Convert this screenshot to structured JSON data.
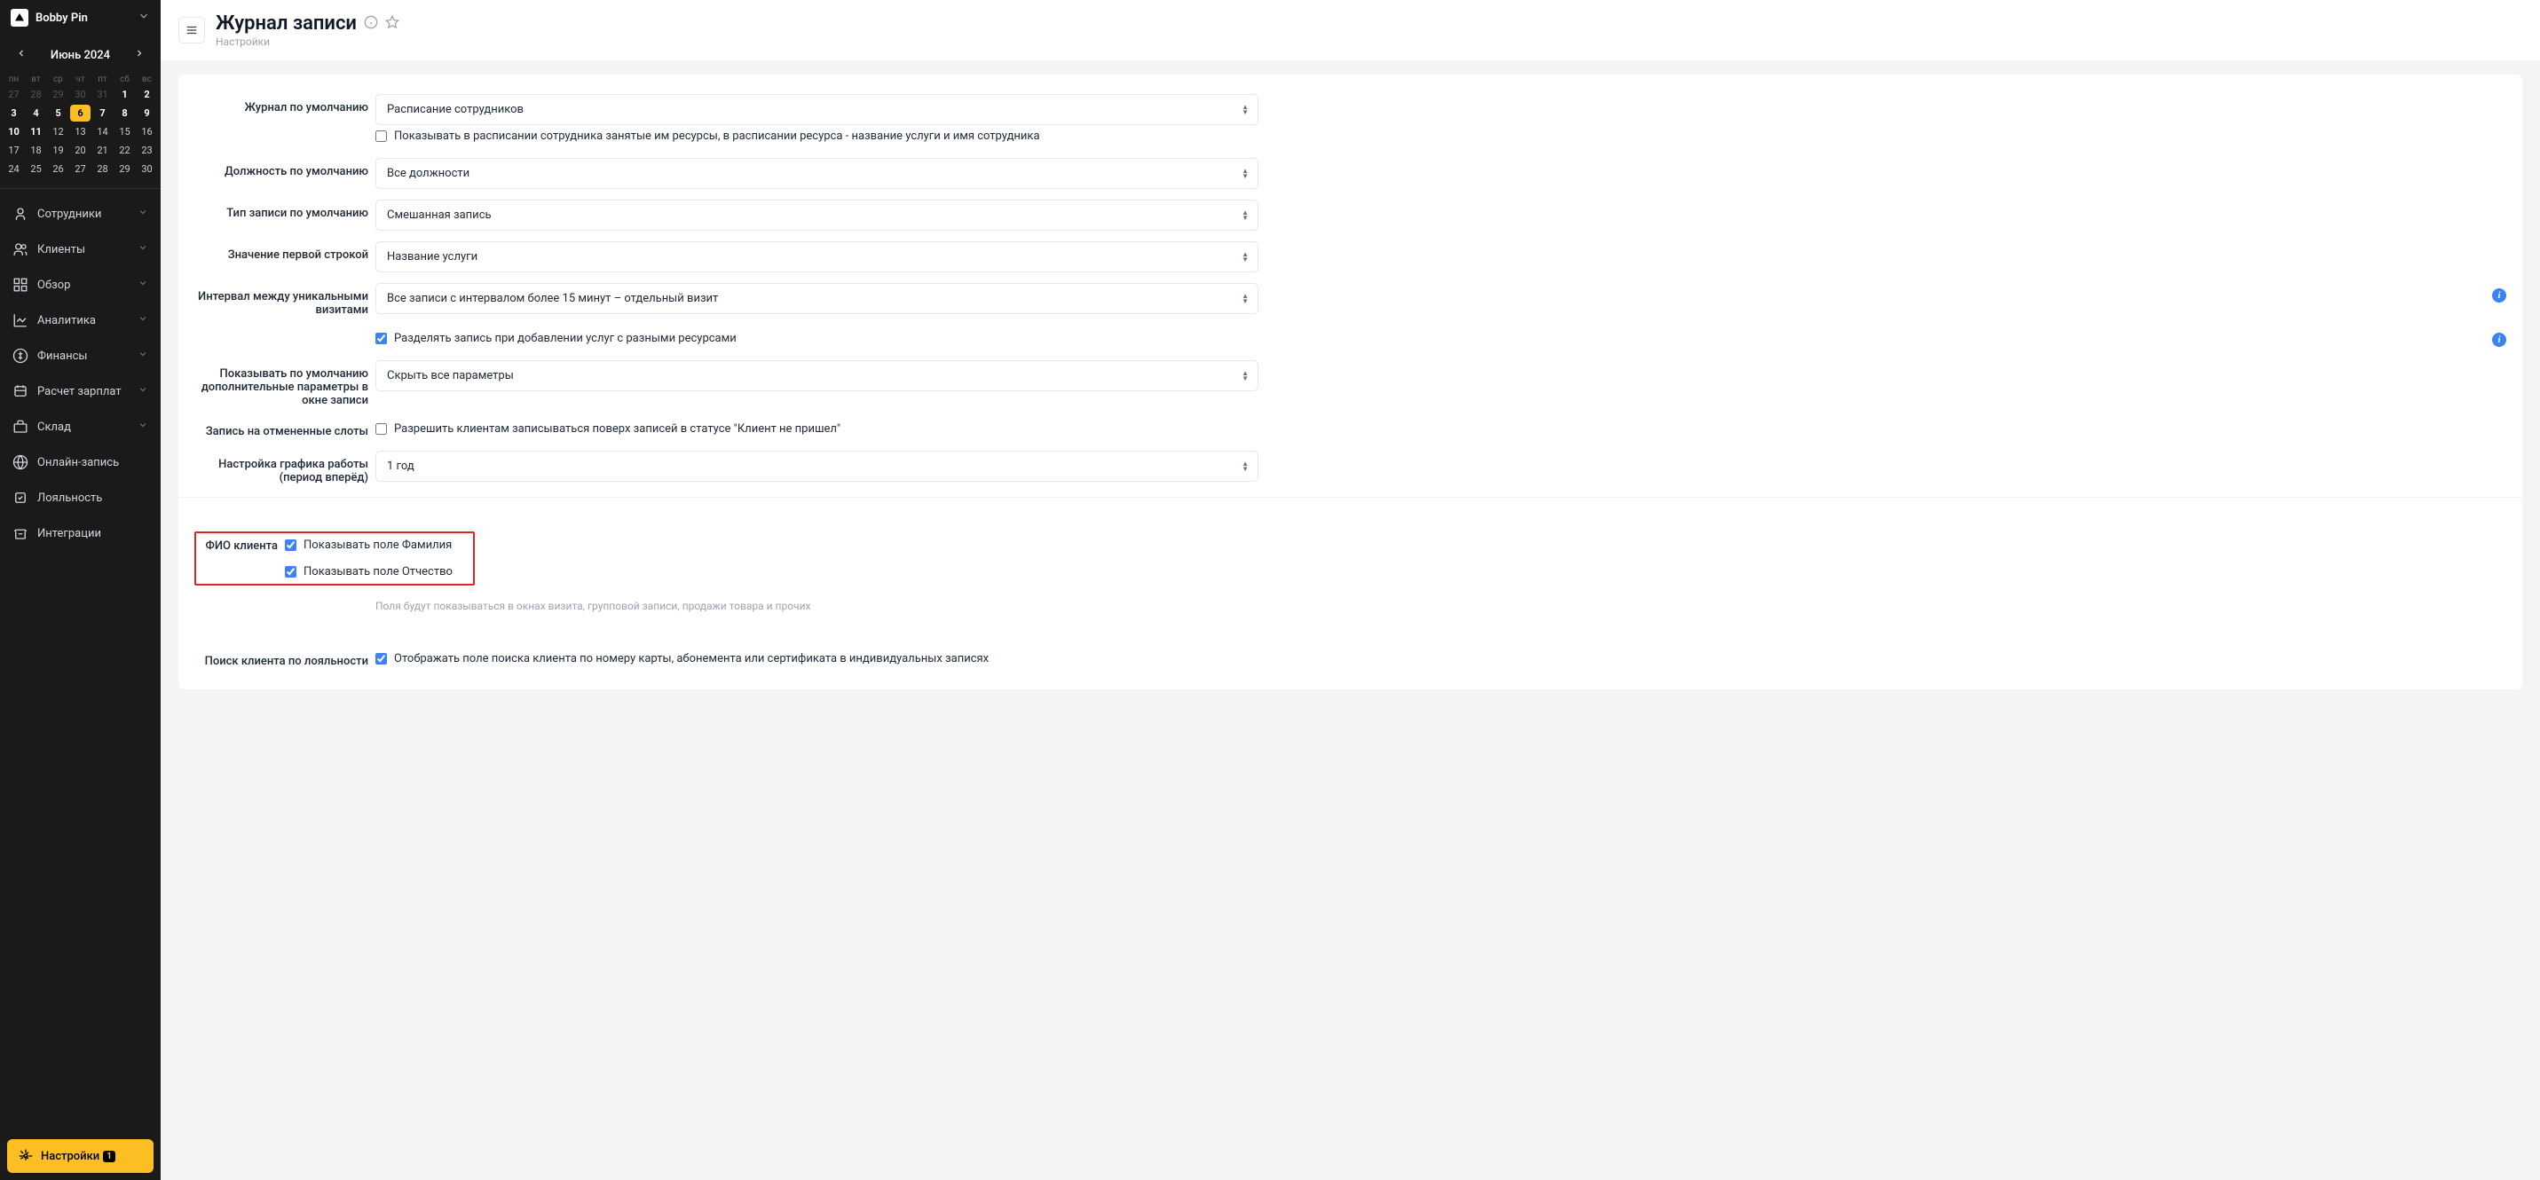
{
  "sidebar": {
    "brand": "Bobby Pin",
    "month": "Июнь 2024",
    "dow": [
      "пн",
      "вт",
      "ср",
      "чт",
      "пт",
      "сб",
      "вс"
    ],
    "weeks": [
      [
        {
          "d": "27",
          "m": true
        },
        {
          "d": "28",
          "m": true
        },
        {
          "d": "29",
          "m": true
        },
        {
          "d": "30",
          "m": true
        },
        {
          "d": "31",
          "m": true
        },
        {
          "d": "1",
          "b": true
        },
        {
          "d": "2",
          "b": true
        }
      ],
      [
        {
          "d": "3",
          "b": true
        },
        {
          "d": "4",
          "b": true
        },
        {
          "d": "5",
          "b": true
        },
        {
          "d": "6",
          "t": true
        },
        {
          "d": "7",
          "b": true
        },
        {
          "d": "8",
          "b": true
        },
        {
          "d": "9",
          "b": true
        }
      ],
      [
        {
          "d": "10",
          "b": true
        },
        {
          "d": "11",
          "b": true
        },
        {
          "d": "12"
        },
        {
          "d": "13"
        },
        {
          "d": "14"
        },
        {
          "d": "15"
        },
        {
          "d": "16"
        }
      ],
      [
        {
          "d": "17"
        },
        {
          "d": "18"
        },
        {
          "d": "19"
        },
        {
          "d": "20"
        },
        {
          "d": "21"
        },
        {
          "d": "22"
        },
        {
          "d": "23"
        }
      ],
      [
        {
          "d": "24"
        },
        {
          "d": "25"
        },
        {
          "d": "26"
        },
        {
          "d": "27"
        },
        {
          "d": "28"
        },
        {
          "d": "29"
        },
        {
          "d": "30"
        }
      ]
    ],
    "nav": [
      {
        "label": "Сотрудники",
        "chev": true
      },
      {
        "label": "Клиенты",
        "chev": true
      },
      {
        "label": "Обзор",
        "chev": true
      },
      {
        "label": "Аналитика",
        "chev": true
      },
      {
        "label": "Финансы",
        "chev": true
      },
      {
        "label": "Расчет зарплат",
        "chev": true
      },
      {
        "label": "Склад",
        "chev": true
      },
      {
        "label": "Онлайн-запись",
        "chev": false
      },
      {
        "label": "Лояльность",
        "chev": false
      },
      {
        "label": "Интеграции",
        "chev": false
      }
    ],
    "settings_label": "Настройки",
    "settings_badge": "1"
  },
  "header": {
    "title": "Журнал записи",
    "breadcrumb": "Настройки"
  },
  "form": {
    "journal_default": {
      "label": "Журнал по умолчанию",
      "value": "Расписание сотрудников",
      "checkbox": "Показывать в расписании сотрудника занятые им ресурсы, в расписании ресурса - название услуги и имя сотрудника"
    },
    "position_default": {
      "label": "Должность по умолчанию",
      "value": "Все должности"
    },
    "record_type": {
      "label": "Тип записи по умолчанию",
      "value": "Смешанная запись"
    },
    "first_line": {
      "label": "Значение первой строкой",
      "value": "Название услуги"
    },
    "interval": {
      "label": "Интервал между уникальными визитами",
      "value": "Все записи с интервалом более 15 минут – отдельный визит",
      "checkbox": "Разделять запись при добавлении услуг с разными ресурсами"
    },
    "extra_params": {
      "label": "Показывать по умолчанию дополнительные параметры в окне записи",
      "value": "Скрыть все параметры"
    },
    "cancelled": {
      "label": "Запись на отмененные слоты",
      "checkbox": "Разрешить клиентам записываться поверх записей в статусе \"Клиент не пришел\""
    },
    "schedule": {
      "label": "Настройка графика работы (период вперёд)",
      "value": "1 год"
    },
    "fio": {
      "label": "ФИО клиента",
      "cb1": "Показывать поле Фамилия",
      "cb2": "Показывать поле Отчество",
      "helper": "Поля будут показываться в окнах визита, групповой записи, продажи товара и прочих"
    },
    "loyalty": {
      "label": "Поиск клиента по лояльности",
      "checkbox": "Отображать поле поиска клиента по номеру карты, абонемента или сертификата в индивидуальных записях"
    }
  }
}
